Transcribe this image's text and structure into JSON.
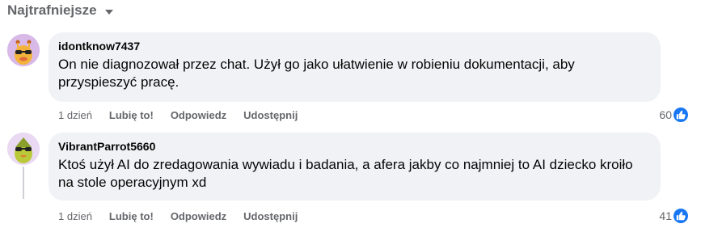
{
  "sort": {
    "label": "Najtrafniejsze"
  },
  "comments": [
    {
      "author": "idontknow7437",
      "text": "On nie diagnozował przez chat. Użył go jako ułatwienie w robieniu dokumentacji, aby przyspieszyć pracę.",
      "time": "1 dzień",
      "like_label": "Lubię to!",
      "reply_label": "Odpowiedz",
      "share_label": "Udostępnij",
      "reaction_count": "60",
      "reaction_icon": "thumbs-up-icon",
      "avatar_bg": "#d8b9e8"
    },
    {
      "author": "VibrantParrot5660",
      "text": "Ktoś użył AI do zredagowania wywiadu i badania, a afera jakby co najmniej to AI dziecko kroiło na stole operacyjnym xd",
      "time": "1 dzień",
      "like_label": "Lubię to!",
      "reply_label": "Odpowiedz",
      "share_label": "Udostępnij",
      "reaction_count": "41",
      "reaction_icon": "thumbs-up-icon",
      "avatar_bg": "#e9d9f2"
    }
  ],
  "colors": {
    "accent": "#1877f2",
    "bubble": "#f0f2f5",
    "muted": "#65676b"
  }
}
